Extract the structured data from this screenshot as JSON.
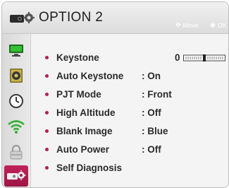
{
  "header": {
    "title": "OPTION 2",
    "hint_move": "Move",
    "hint_ok": "OK"
  },
  "sidebar": {
    "items": [
      {
        "icon": "monitor-icon"
      },
      {
        "icon": "speaker-icon"
      },
      {
        "icon": "clock-icon"
      },
      {
        "icon": "wifi-icon"
      },
      {
        "icon": "lock-icon"
      },
      {
        "icon": "projector-gear-icon",
        "selected": true
      }
    ]
  },
  "menu": {
    "items": [
      {
        "label": "Keystone",
        "value": "0",
        "slider_level": 0.5
      },
      {
        "label": "Auto Keystone",
        "value": ": On"
      },
      {
        "label": "PJT Mode",
        "value": ": Front"
      },
      {
        "label": "High Altitude",
        "value": ": Off"
      },
      {
        "label": "Blank Image",
        "value": ": Blue"
      },
      {
        "label": "Auto Power",
        "value": ": Off"
      },
      {
        "label": "Self Diagnosis",
        "value": ""
      }
    ]
  },
  "colors": {
    "accent": "#b51e53",
    "selected_tab": "#a8184c"
  }
}
